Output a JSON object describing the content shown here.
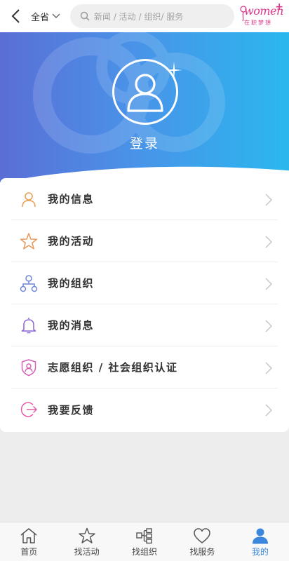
{
  "header": {
    "region": "全省",
    "search_placeholder": "新闻 / 活动 / 组织/ 服务",
    "logo_text": "women",
    "logo_plus": "+",
    "logo_sub": "在职梦想"
  },
  "hero": {
    "login_label": "登录"
  },
  "menu": {
    "items": [
      {
        "label": "我的信息",
        "icon": "user-icon",
        "color": "#e9a15a"
      },
      {
        "label": "我的活动",
        "icon": "star-icon",
        "color": "#e9965a"
      },
      {
        "label": "我的组织",
        "icon": "org-icon",
        "color": "#6f86d6"
      },
      {
        "label": "我的消息",
        "icon": "bell-icon",
        "color": "#8b63d6"
      },
      {
        "label": "志愿组织 / 社会组织认证",
        "icon": "shield-user-icon",
        "color": "#d45fb5"
      },
      {
        "label": "我要反馈",
        "icon": "exit-icon",
        "color": "#e25fa3"
      }
    ]
  },
  "tabbar": {
    "tabs": [
      {
        "label": "首页",
        "icon": "home-icon"
      },
      {
        "label": "找活动",
        "icon": "star-icon"
      },
      {
        "label": "找组织",
        "icon": "org-icon"
      },
      {
        "label": "找服务",
        "icon": "heart-icon"
      },
      {
        "label": "我的",
        "icon": "user-icon",
        "active": true
      }
    ],
    "active_color": "#3b87dd"
  },
  "colors": {
    "hero_start": "#5b6ed6",
    "hero_end": "#2bb7ee",
    "brand": "#d9358a"
  }
}
